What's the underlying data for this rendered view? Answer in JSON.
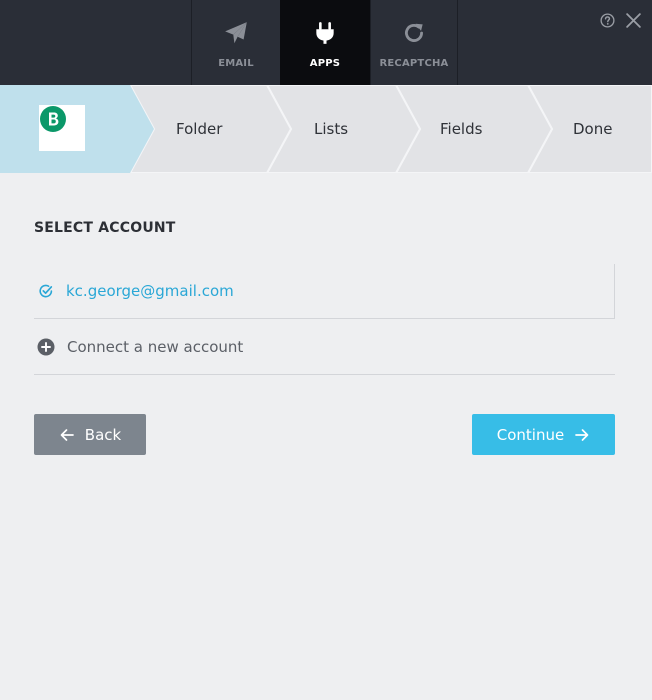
{
  "tabs": [
    {
      "label": "EMAIL",
      "icon": "paper-plane-icon",
      "active": false
    },
    {
      "label": "APPS",
      "icon": "plug-icon",
      "active": true
    },
    {
      "label": "RECAPTCHA",
      "icon": "refresh-icon",
      "active": false
    }
  ],
  "header_icons": {
    "help": "help-icon",
    "close": "close-icon"
  },
  "steps": {
    "brand_letter": "B",
    "items": [
      {
        "label": "Folder"
      },
      {
        "label": "Lists"
      },
      {
        "label": "Fields"
      },
      {
        "label": "Done"
      }
    ]
  },
  "account": {
    "section_title": "SELECT ACCOUNT",
    "selected_email": "kc.george@gmail.com",
    "connect_label": "Connect a new account"
  },
  "buttons": {
    "back_label": "Back",
    "continue_label": "Continue"
  },
  "colors": {
    "topbar": "#2a2e37",
    "active_tab": "#0b0c0f",
    "active_step": "#bfe0ec",
    "step": "#e2e3e6",
    "accent": "#37bde7",
    "back_button": "#7d858e",
    "brand": "#0b9869"
  }
}
